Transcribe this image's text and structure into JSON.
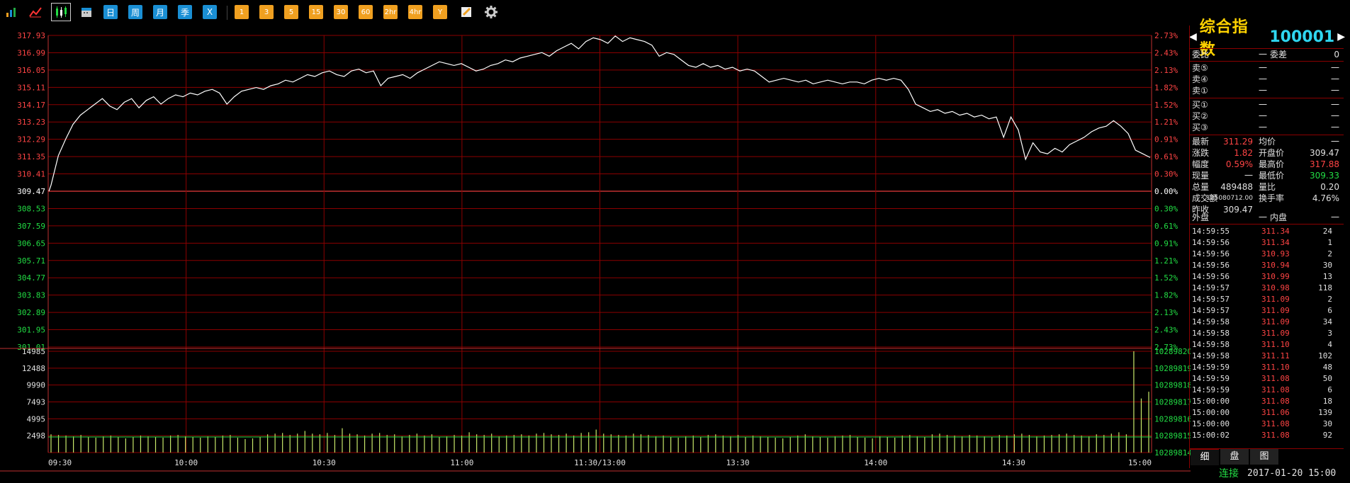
{
  "toolbar": {
    "icons": [
      "bar-chart-icon",
      "line-chart-icon",
      "candlestick-icon",
      "calendar-icon"
    ],
    "periods": [
      "日",
      "周",
      "月",
      "季",
      "X"
    ],
    "minutes": [
      "1",
      "3",
      "5",
      "15",
      "30",
      "60",
      "2hr",
      "4hr",
      "Y"
    ],
    "tools": [
      "pencil-icon",
      "gear-icon"
    ]
  },
  "chart_data": {
    "type": "line",
    "price_axis_left": [
      "317.93",
      "316.99",
      "316.05",
      "315.11",
      "314.17",
      "313.23",
      "312.29",
      "311.35",
      "310.41",
      "309.47",
      "308.53",
      "307.59",
      "306.65",
      "305.71",
      "304.77",
      "303.83",
      "302.89",
      "301.95",
      "301.01"
    ],
    "pct_axis_right": [
      "2.73%",
      "2.43%",
      "2.13%",
      "1.82%",
      "1.52%",
      "1.21%",
      "0.91%",
      "0.61%",
      "0.30%",
      "0.00%",
      "0.30%",
      "0.61%",
      "0.91%",
      "1.21%",
      "1.52%",
      "1.82%",
      "2.13%",
      "2.43%",
      "2.73%"
    ],
    "volume_axis_left": [
      "14985",
      "12488",
      "9990",
      "7493",
      "4995",
      "2498"
    ],
    "volume_axis_right": [
      "10289820",
      "10289819",
      "10289818",
      "10289817",
      "10289816",
      "10289815",
      "10289814"
    ],
    "time_labels": [
      "09:30",
      "10:00",
      "10:30",
      "11:00",
      "11:30/13:00",
      "13:30",
      "14:00",
      "14:30",
      "15:00"
    ],
    "prev_close": 309.47,
    "ylim": [
      301.01,
      317.93
    ],
    "price_series": [
      309.8,
      311.4,
      312.3,
      313.1,
      313.6,
      313.9,
      314.2,
      314.5,
      314.1,
      313.9,
      314.3,
      314.5,
      314.0,
      314.4,
      314.6,
      314.2,
      314.5,
      314.7,
      314.6,
      314.8,
      314.7,
      314.9,
      315.0,
      314.8,
      314.2,
      314.6,
      314.9,
      315.0,
      315.1,
      315.0,
      315.2,
      315.3,
      315.5,
      315.4,
      315.6,
      315.8,
      315.7,
      315.9,
      316.0,
      315.8,
      315.7,
      316.0,
      316.1,
      315.9,
      316.0,
      315.2,
      315.6,
      315.7,
      315.8,
      315.6,
      315.9,
      316.1,
      316.3,
      316.5,
      316.4,
      316.3,
      316.4,
      316.2,
      316.0,
      316.1,
      316.3,
      316.4,
      316.6,
      316.5,
      316.7,
      316.8,
      316.9,
      317.0,
      316.8,
      317.1,
      317.3,
      317.5,
      317.2,
      317.6,
      317.8,
      317.7,
      317.5,
      317.9,
      317.6,
      317.8,
      317.7,
      317.6,
      317.4,
      316.8,
      317.0,
      316.9,
      316.6,
      316.3,
      316.2,
      316.4,
      316.2,
      316.3,
      316.1,
      316.2,
      316.0,
      316.1,
      316.0,
      315.7,
      315.4,
      315.5,
      315.6,
      315.5,
      315.4,
      315.5,
      315.3,
      315.4,
      315.5,
      315.4,
      315.3,
      315.4,
      315.4,
      315.3,
      315.5,
      315.6,
      315.5,
      315.6,
      315.5,
      315.0,
      314.2,
      314.0,
      313.8,
      313.9,
      313.7,
      313.8,
      313.6,
      313.7,
      313.5,
      313.6,
      313.4,
      313.5,
      312.4,
      313.5,
      312.8,
      311.2,
      312.1,
      311.6,
      311.5,
      311.8,
      311.6,
      312.0,
      312.2,
      312.4,
      312.7,
      312.9,
      313.0,
      313.3,
      313.0,
      312.6,
      311.7,
      311.5,
      311.3
    ],
    "volume_series": [
      2700,
      2600,
      2500,
      2400,
      2600,
      2300,
      2200,
      2400,
      2500,
      2300,
      2100,
      2300,
      2500,
      2400,
      2300,
      2200,
      2500,
      2600,
      2400,
      2300,
      2200,
      2400,
      2300,
      2500,
      2600,
      2200,
      2000,
      2100,
      2300,
      2700,
      2800,
      2900,
      2600,
      2800,
      3200,
      2800,
      2700,
      2900,
      2600,
      3600,
      2800,
      2700,
      2500,
      2800,
      2900,
      2600,
      2700,
      2400,
      2600,
      2800,
      2500,
      2700,
      2300,
      2400,
      2600,
      2500,
      3000,
      2700,
      2600,
      2800,
      2400,
      2500,
      2600,
      2700,
      2500,
      2800,
      2900,
      2700,
      2600,
      2800,
      2500,
      2900,
      3000,
      3400,
      2800,
      2700,
      2600,
      2500,
      2800,
      2700,
      2600,
      2400,
      2500,
      2300,
      2200,
      2400,
      2500,
      2300,
      2600,
      2700,
      2500,
      2400,
      2600,
      2300,
      2500,
      2400,
      2300,
      2200,
      2100,
      2300,
      2500,
      2700,
      2400,
      2300,
      2200,
      2400,
      2500,
      2600,
      2300,
      2200,
      2100,
      2400,
      2300,
      2200,
      2500,
      2600,
      2400,
      2300,
      2700,
      2800,
      2600,
      2500,
      2400,
      2600,
      2500,
      2400,
      2300,
      2600,
      2500,
      2700,
      2800,
      2600,
      2400,
      2500,
      2600,
      2700,
      2800,
      2600,
      2500,
      2400,
      2700,
      2600,
      2800,
      3000,
      2700,
      14985,
      8000,
      9000
    ]
  },
  "sidebar": {
    "title_name": "综合指数",
    "title_code": "100001",
    "weibi_label": "委比",
    "weibi_value": "一",
    "weicha_label": "委差",
    "weicha_value": "0",
    "sell": [
      {
        "label": "卖⑤",
        "p": "一",
        "v": "一"
      },
      {
        "label": "卖④",
        "p": "一",
        "v": "一"
      },
      {
        "label": "卖①",
        "p": "一",
        "v": "一"
      }
    ],
    "buy": [
      {
        "label": "买①",
        "p": "一",
        "v": "一"
      },
      {
        "label": "买②",
        "p": "一",
        "v": "一"
      },
      {
        "label": "买③",
        "p": "一",
        "v": "一"
      }
    ],
    "stats": [
      {
        "l1": "最新",
        "v1": "311.29",
        "c1": "red",
        "l2": "均价",
        "v2": "一",
        "c2": "wht"
      },
      {
        "l1": "涨跌",
        "v1": "1.82",
        "c1": "red",
        "l2": "开盘价",
        "v2": "309.47",
        "c2": "wht"
      },
      {
        "l1": "幅度",
        "v1": "0.59%",
        "c1": "red",
        "l2": "最高价",
        "v2": "317.88",
        "c2": "red"
      },
      {
        "l1": "现量",
        "v1": "一",
        "c1": "wht",
        "l2": "最低价",
        "v2": "309.33",
        "c2": "grn"
      },
      {
        "l1": "总量",
        "v1": "489488",
        "c1": "wht",
        "l2": "量比",
        "v2": "0.20",
        "c2": "wht"
      },
      {
        "l1": "成交额",
        "v1": "125080712.00",
        "c1": "wht",
        "l2": "换手率",
        "v2": "4.76%",
        "c2": "wht"
      },
      {
        "l1": "昨收",
        "v1": "309.47",
        "c1": "wht",
        "l2": "",
        "v2": "",
        "c2": "wht"
      }
    ],
    "waipan_label": "外盘",
    "waipan_value": "一",
    "neipan_label": "内盘",
    "neipan_value": "一",
    "ticks": [
      {
        "t": "14:59:55",
        "p": "311.34",
        "v": "24"
      },
      {
        "t": "14:59:56",
        "p": "311.34",
        "v": "1"
      },
      {
        "t": "14:59:56",
        "p": "310.93",
        "v": "2"
      },
      {
        "t": "14:59:56",
        "p": "310.94",
        "v": "30"
      },
      {
        "t": "14:59:56",
        "p": "310.99",
        "v": "13"
      },
      {
        "t": "14:59:57",
        "p": "310.98",
        "v": "118"
      },
      {
        "t": "14:59:57",
        "p": "311.09",
        "v": "2"
      },
      {
        "t": "14:59:57",
        "p": "311.09",
        "v": "6"
      },
      {
        "t": "14:59:58",
        "p": "311.09",
        "v": "34"
      },
      {
        "t": "14:59:58",
        "p": "311.09",
        "v": "3"
      },
      {
        "t": "14:59:58",
        "p": "311.10",
        "v": "4"
      },
      {
        "t": "14:59:58",
        "p": "311.11",
        "v": "102"
      },
      {
        "t": "14:59:59",
        "p": "311.10",
        "v": "48"
      },
      {
        "t": "14:59:59",
        "p": "311.08",
        "v": "50"
      },
      {
        "t": "14:59:59",
        "p": "311.08",
        "v": "6"
      },
      {
        "t": "15:00:00",
        "p": "311.08",
        "v": "18"
      },
      {
        "t": "15:00:00",
        "p": "311.06",
        "v": "139"
      },
      {
        "t": "15:00:00",
        "p": "311.08",
        "v": "30"
      },
      {
        "t": "15:00:02",
        "p": "311.08",
        "v": "92"
      }
    ],
    "tabs": [
      "细",
      "盘",
      "图"
    ]
  },
  "status": {
    "connection": "连接",
    "datetime": "2017-01-20 15:00"
  },
  "colors": {
    "grid": "#8b0000",
    "price_line": "#ffffff",
    "up": "#ff4444",
    "down": "#22dd44",
    "volume": "#c8e86a"
  }
}
